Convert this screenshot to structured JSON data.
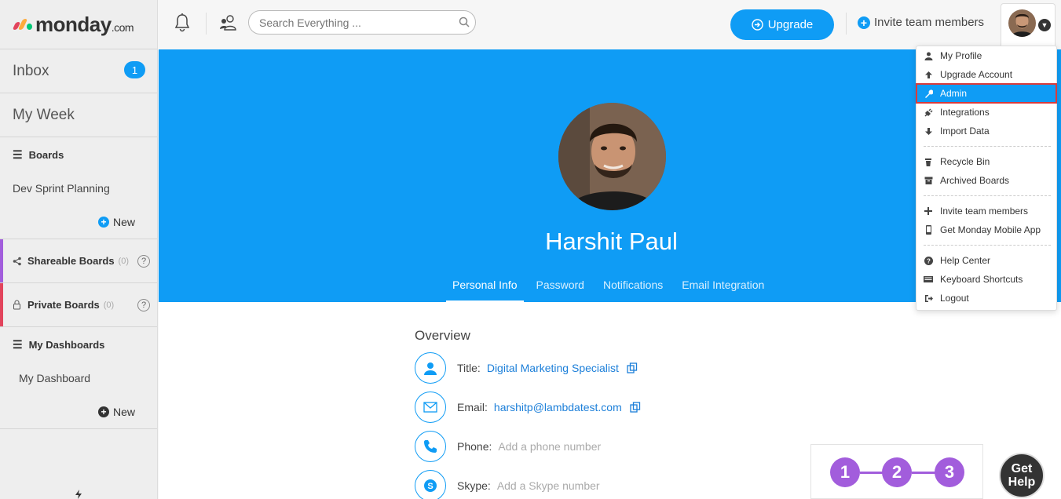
{
  "logo": {
    "name": "monday",
    "suffix": ".com",
    "colors": [
      "#e2445c",
      "#fdab3d",
      "#00c875"
    ]
  },
  "sidebar": {
    "inbox_label": "Inbox",
    "inbox_count": "1",
    "my_week_label": "My Week",
    "boards_header": "Boards",
    "boards": [
      "Dev Sprint Planning"
    ],
    "new_label": "New",
    "shareable_label": "Shareable Boards",
    "shareable_count": "(0)",
    "private_label": "Private Boards",
    "private_count": "(0)",
    "dashboards_header": "My Dashboards",
    "dashboards": [
      "My Dashboard"
    ],
    "new_dashboard_label": "New",
    "help_glyph": "?"
  },
  "topbar": {
    "search_placeholder": "Search Everything ...",
    "upgrade_label": "Upgrade",
    "invite_label": "Invite team members"
  },
  "profile": {
    "name": "Harshit Paul",
    "tabs": [
      "Personal Info",
      "Password",
      "Notifications",
      "Email Integration"
    ],
    "active_tab": "Personal Info"
  },
  "overview": {
    "heading": "Overview",
    "title_label": "Title:",
    "title_value": "Digital Marketing Specialist",
    "email_label": "Email:",
    "email_value": "harshitp@lambdatest.com",
    "phone_label": "Phone:",
    "phone_placeholder": "Add a phone number",
    "skype_label": "Skype:",
    "skype_placeholder": "Add a Skype number"
  },
  "dropdown": {
    "items": [
      {
        "label": "My Profile",
        "icon": "user-icon"
      },
      {
        "label": "Upgrade Account",
        "icon": "arrow-up-icon"
      },
      {
        "label": "Admin",
        "icon": "wrench-icon"
      },
      {
        "label": "Integrations",
        "icon": "plug-icon"
      },
      {
        "label": "Import Data",
        "icon": "arrow-down-icon"
      },
      {
        "label": "Recycle Bin",
        "icon": "trash-icon"
      },
      {
        "label": "Archived Boards",
        "icon": "archive-icon"
      },
      {
        "label": "Invite team members",
        "icon": "plus-icon"
      },
      {
        "label": "Get Monday Mobile App",
        "icon": "mobile-icon"
      },
      {
        "label": "Help Center",
        "icon": "question-icon"
      },
      {
        "label": "Keyboard Shortcuts",
        "icon": "keyboard-icon"
      },
      {
        "label": "Logout",
        "icon": "logout-icon"
      }
    ],
    "highlighted": "Admin"
  },
  "stepper": {
    "steps": [
      "1",
      "2",
      "3"
    ]
  },
  "get_help": {
    "line1": "Get",
    "line2": "Help"
  },
  "colors": {
    "primary": "#0f9cf5",
    "step": "#a25ddc",
    "highlight_border": "#d93b3b"
  }
}
